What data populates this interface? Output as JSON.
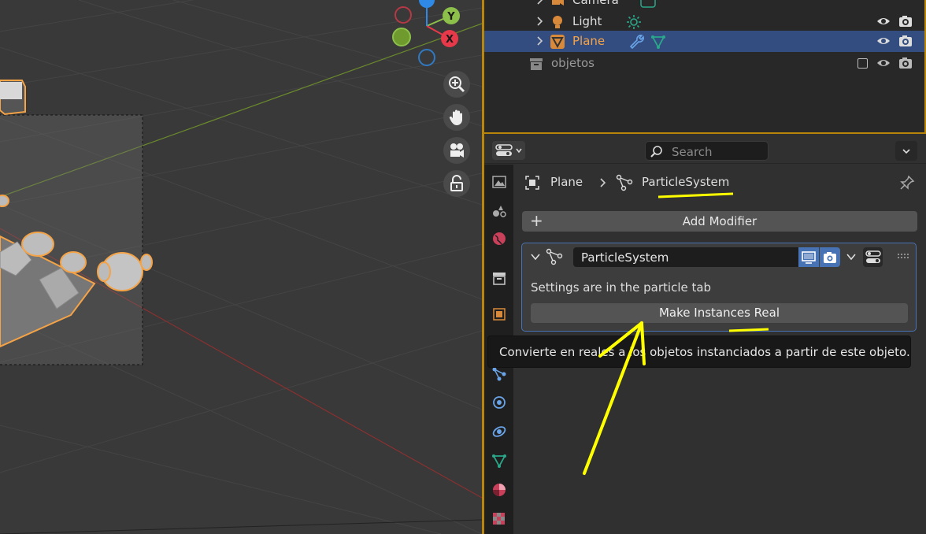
{
  "outliner": {
    "rows": [
      {
        "label": "Camera",
        "selected": false
      },
      {
        "label": "Light",
        "selected": false
      },
      {
        "label": "Plane",
        "selected": true
      },
      {
        "label": "objetos",
        "selected": false
      }
    ]
  },
  "properties": {
    "search_placeholder": "Search",
    "breadcrumb": {
      "object": "Plane",
      "modifier": "ParticleSystem"
    },
    "add_modifier_label": "Add Modifier",
    "modifier": {
      "name": "ParticleSystem",
      "settings_text": "Settings are in the particle tab",
      "make_real_label": "Make Instances Real"
    }
  },
  "tooltip": {
    "text": "Convierte en reales a los objetos instanciados a partir de este objeto."
  },
  "gizmo": {
    "y_label": "Y",
    "x_label": "X"
  },
  "colors": {
    "accent": "#f5a347",
    "selection": "#334d80",
    "active_toggle": "#4772b3",
    "annotation": "#ffff00"
  }
}
